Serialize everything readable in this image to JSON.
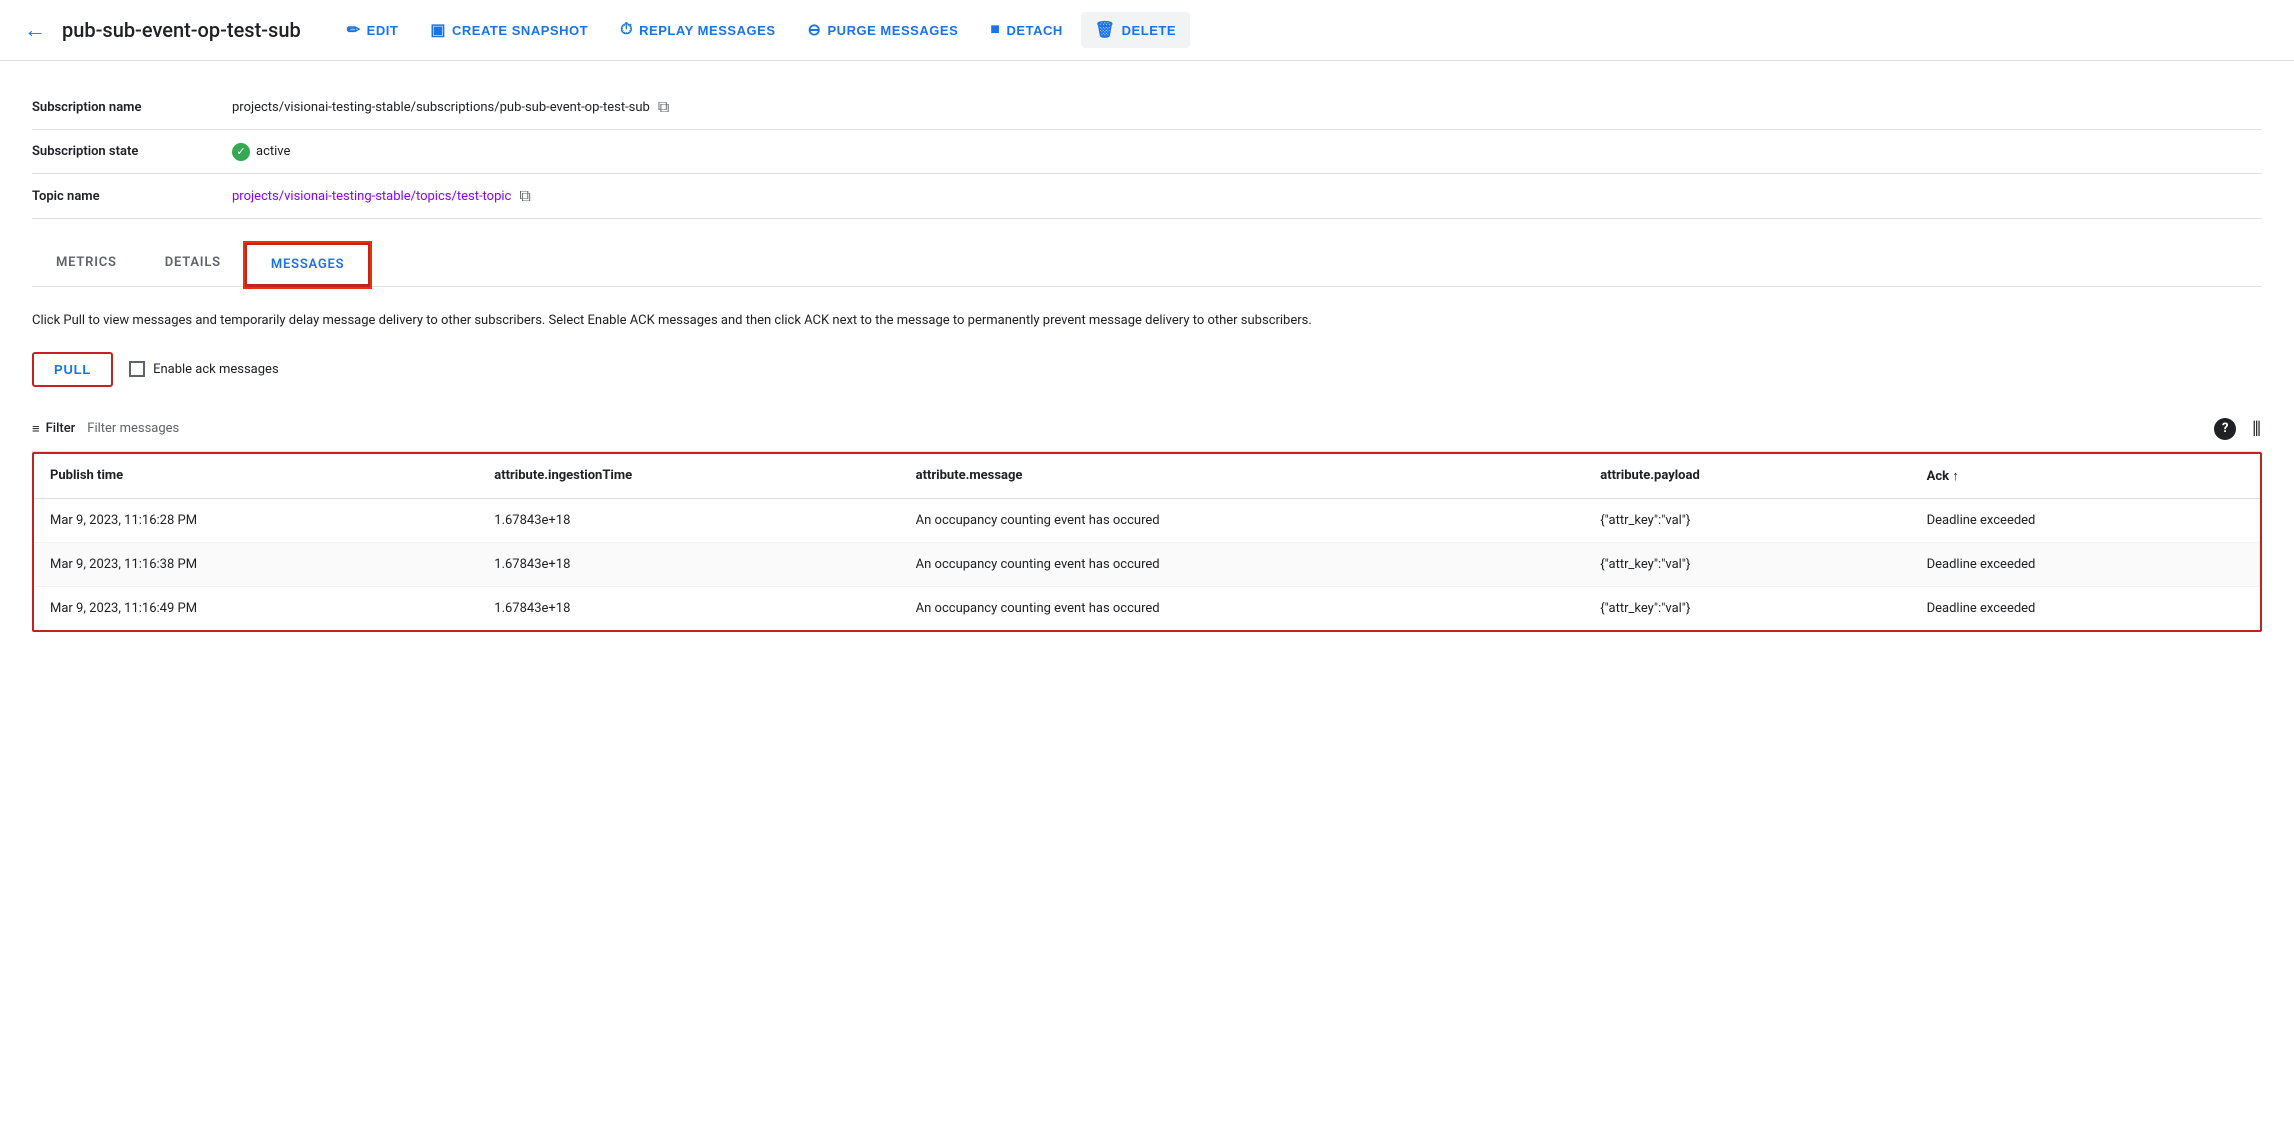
{
  "toolbar": {
    "back_label": "←",
    "title": "pub-sub-event-op-test-sub",
    "edit_label": "EDIT",
    "create_snapshot_label": "CREATE SNAPSHOT",
    "replay_messages_label": "REPLAY MESSAGES",
    "purge_messages_label": "PURGE MESSAGES",
    "detach_label": "DETACH",
    "delete_label": "DELETE"
  },
  "info": {
    "subscription_name_label": "Subscription name",
    "subscription_name_value": "projects/visionai-testing-stable/subscriptions/pub-sub-event-op-test-sub",
    "subscription_state_label": "Subscription state",
    "subscription_state_value": "active",
    "topic_name_label": "Topic name",
    "topic_name_value": "projects/visionai-testing-stable/topics/test-topic"
  },
  "tabs": {
    "metrics_label": "METRICS",
    "details_label": "DETAILS",
    "messages_label": "MESSAGES"
  },
  "messages": {
    "instructions": "Click Pull to view messages and temporarily delay message delivery to other subscribers. Select Enable ACK messages and then click ACK next to the message to permanently prevent message delivery to other subscribers.",
    "pull_label": "PULL",
    "enable_ack_label": "Enable ack messages",
    "filter_label": "Filter",
    "filter_placeholder": "Filter messages"
  },
  "table": {
    "columns": [
      "Publish time",
      "attribute.ingestionTime",
      "attribute.message",
      "attribute.payload",
      "Ack ↑"
    ],
    "rows": [
      {
        "publish_time": "Mar 9, 2023, 11:16:28 PM",
        "ingestion_time": "1.67843e+18",
        "message": "An occupancy counting event has occured",
        "payload": "{\"attr_key\":\"val\"}",
        "ack": "Deadline exceeded"
      },
      {
        "publish_time": "Mar 9, 2023, 11:16:38 PM",
        "ingestion_time": "1.67843e+18",
        "message": "An occupancy counting event has occured",
        "payload": "{\"attr_key\":\"val\"}",
        "ack": "Deadline exceeded"
      },
      {
        "publish_time": "Mar 9, 2023, 11:16:49 PM",
        "ingestion_time": "1.67843e+18",
        "message": "An occupancy counting event has occured",
        "payload": "{\"attr_key\":\"val\"}",
        "ack": "Deadline exceeded"
      }
    ]
  },
  "icons": {
    "back": "←",
    "edit": "✏",
    "camera": "📷",
    "clock": "⏱",
    "circle_minus": "⊖",
    "square": "■",
    "trash": "🗑",
    "copy": "⧉",
    "checkmark": "✓",
    "filter": "≡",
    "help": "?",
    "columns": "⦀",
    "sort_asc": "↑"
  }
}
